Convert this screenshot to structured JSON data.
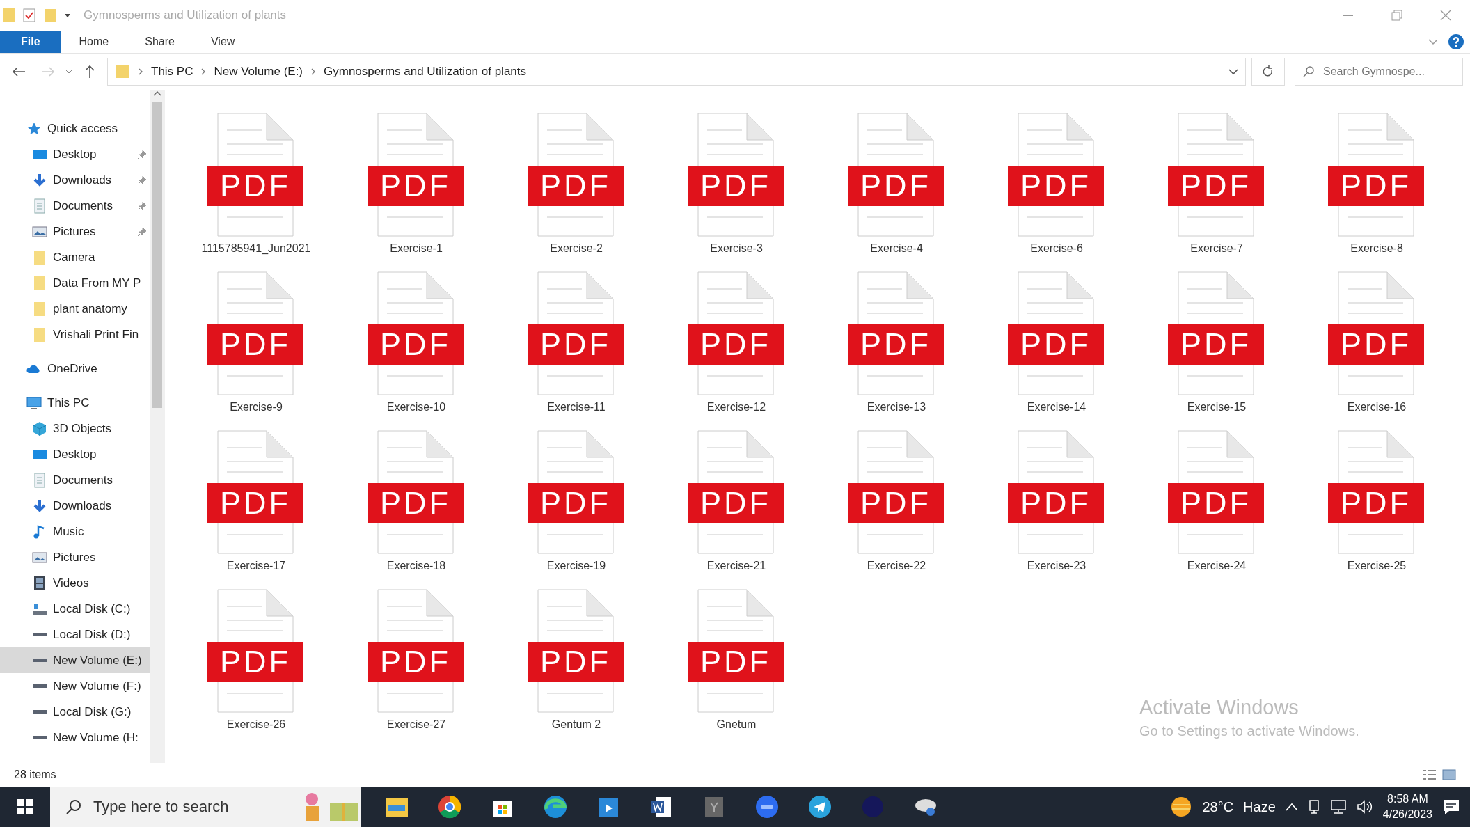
{
  "window": {
    "title": "Gymnosperms and Utilization of plants"
  },
  "ribbon_tabs": [
    {
      "label": "File",
      "selected": true
    },
    {
      "label": "Home",
      "selected": false
    },
    {
      "label": "Share",
      "selected": false
    },
    {
      "label": "View",
      "selected": false
    }
  ],
  "address": {
    "crumbs": [
      "This PC",
      "New Volume (E:)",
      "Gymnosperms and Utilization of plants"
    ]
  },
  "search": {
    "placeholder": "Search Gymnospe..."
  },
  "sidebar": {
    "items": [
      {
        "label": "Quick access",
        "kind": "star",
        "selected": false,
        "children": [
          {
            "label": "Desktop",
            "kind": "desktop",
            "pinned": true,
            "selected": false
          },
          {
            "label": "Downloads",
            "kind": "download",
            "pinned": true,
            "selected": false
          },
          {
            "label": "Documents",
            "kind": "document",
            "pinned": true,
            "selected": false
          },
          {
            "label": "Pictures",
            "kind": "picture",
            "pinned": true,
            "selected": false
          },
          {
            "label": "Camera",
            "kind": "folder",
            "pinned": false,
            "selected": false
          },
          {
            "label": "Data From MY P",
            "kind": "folder",
            "pinned": false,
            "selected": false
          },
          {
            "label": "plant anatomy",
            "kind": "folder",
            "pinned": false,
            "selected": false
          },
          {
            "label": "Vrishali Print Fin",
            "kind": "folder",
            "pinned": false,
            "selected": false
          }
        ]
      },
      {
        "label": "OneDrive",
        "kind": "cloud",
        "selected": false
      },
      {
        "label": "This PC",
        "kind": "pc",
        "selected": false,
        "children": [
          {
            "label": "3D Objects",
            "kind": "cube",
            "pinned": false,
            "selected": false
          },
          {
            "label": "Desktop",
            "kind": "desktop",
            "pinned": false,
            "selected": false
          },
          {
            "label": "Documents",
            "kind": "document",
            "pinned": false,
            "selected": false
          },
          {
            "label": "Downloads",
            "kind": "download",
            "pinned": false,
            "selected": false
          },
          {
            "label": "Music",
            "kind": "music",
            "pinned": false,
            "selected": false
          },
          {
            "label": "Pictures",
            "kind": "picture",
            "pinned": false,
            "selected": false
          },
          {
            "label": "Videos",
            "kind": "video",
            "pinned": false,
            "selected": false
          },
          {
            "label": "Local Disk (C:)",
            "kind": "osdisk",
            "pinned": false,
            "selected": false
          },
          {
            "label": "Local Disk (D:)",
            "kind": "disk",
            "pinned": false,
            "selected": false
          },
          {
            "label": "New Volume (E:)",
            "kind": "disk",
            "pinned": false,
            "selected": true
          },
          {
            "label": "New Volume (F:)",
            "kind": "disk",
            "pinned": false,
            "selected": false
          },
          {
            "label": "Local Disk (G:)",
            "kind": "disk",
            "pinned": false,
            "selected": false
          },
          {
            "label": "New Volume (H:",
            "kind": "disk",
            "pinned": false,
            "selected": false
          }
        ]
      }
    ]
  },
  "files": [
    {
      "name": "1115785941_Jun2021",
      "badge": "PDF"
    },
    {
      "name": "Exercise-1",
      "badge": "PDF"
    },
    {
      "name": "Exercise-2",
      "badge": "PDF"
    },
    {
      "name": "Exercise-3",
      "badge": "PDF"
    },
    {
      "name": "Exercise-4",
      "badge": "PDF"
    },
    {
      "name": "Exercise-6",
      "badge": "PDF"
    },
    {
      "name": "Exercise-7",
      "badge": "PDF"
    },
    {
      "name": "Exercise-8",
      "badge": "PDF"
    },
    {
      "name": "Exercise-9",
      "badge": "PDF"
    },
    {
      "name": "Exercise-10",
      "badge": "PDF"
    },
    {
      "name": "Exercise-11",
      "badge": "PDF"
    },
    {
      "name": "Exercise-12",
      "badge": "PDF"
    },
    {
      "name": "Exercise-13",
      "badge": "PDF"
    },
    {
      "name": "Exercise-14",
      "badge": "PDF"
    },
    {
      "name": "Exercise-15",
      "badge": "PDF"
    },
    {
      "name": "Exercise-16",
      "badge": "PDF"
    },
    {
      "name": "Exercise-17",
      "badge": "PDF"
    },
    {
      "name": "Exercise-18",
      "badge": "PDF"
    },
    {
      "name": "Exercise-19",
      "badge": "PDF"
    },
    {
      "name": "Exercise-21",
      "badge": "PDF"
    },
    {
      "name": "Exercise-22",
      "badge": "PDF"
    },
    {
      "name": "Exercise-23",
      "badge": "PDF"
    },
    {
      "name": "Exercise-24",
      "badge": "PDF"
    },
    {
      "name": "Exercise-25",
      "badge": "PDF"
    },
    {
      "name": "Exercise-26",
      "badge": "PDF"
    },
    {
      "name": "Exercise-27",
      "badge": "PDF"
    },
    {
      "name": "Gentum 2",
      "badge": "PDF"
    },
    {
      "name": "Gnetum",
      "badge": "PDF"
    }
  ],
  "activation_notice": {
    "title": "Activate Windows",
    "text": "Go to Settings to activate Windows."
  },
  "status_bar": {
    "item_count": "28 items"
  },
  "taskbar": {
    "search_placeholder": "Type here to search",
    "weather": {
      "temperature": "28°C",
      "condition": "Haze"
    },
    "time": "8:58 AM",
    "date": "4/26/2023"
  }
}
